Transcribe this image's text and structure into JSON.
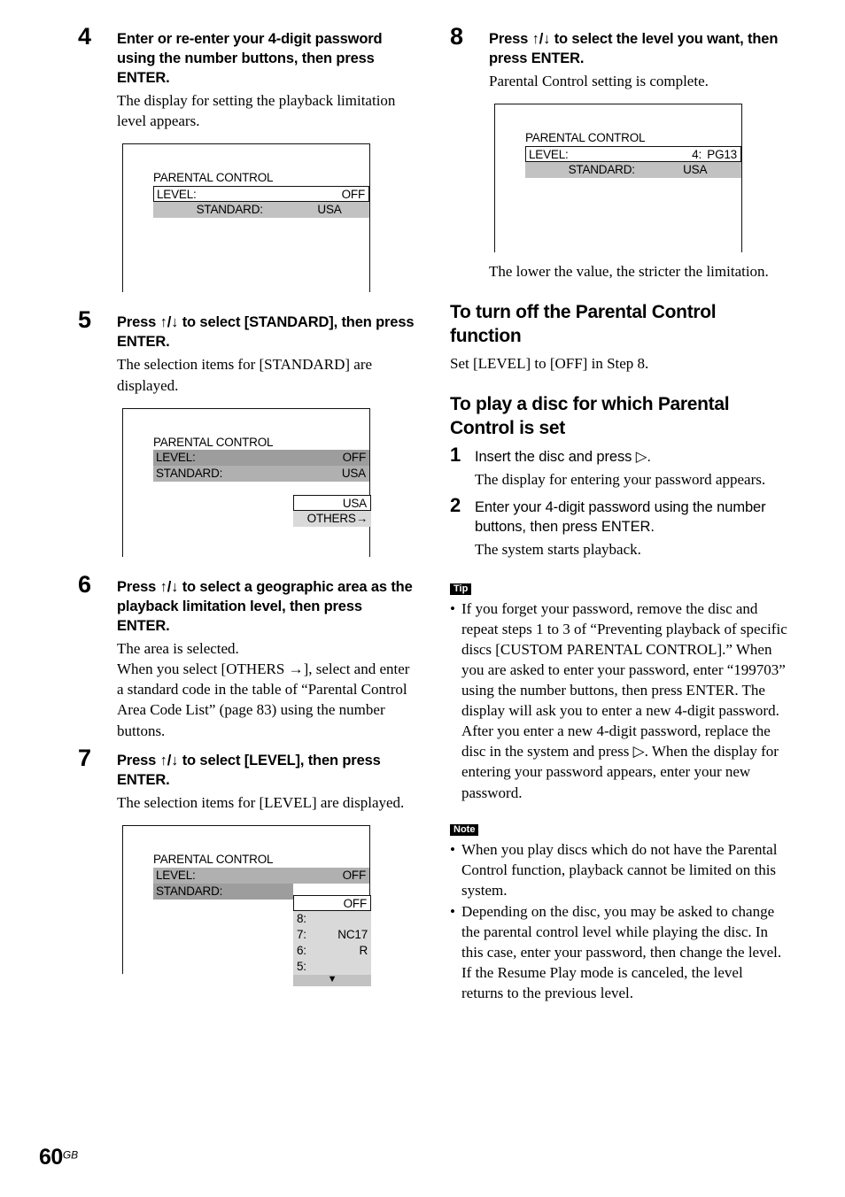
{
  "page": {
    "number": "60",
    "region_suffix": "GB"
  },
  "glyphs": {
    "up_down": "↑/↓",
    "play": "▷",
    "right_arrow": "→",
    "down_triangle": "▼"
  },
  "left_column": {
    "steps": [
      {
        "number": "4",
        "title": "Enter or re-enter your 4-digit password using the number buttons, then press ENTER.",
        "description": "The display for setting the playback limitation level appears."
      },
      {
        "number": "5",
        "title": "Press ↑/↓ to select [STANDARD], then press ENTER.",
        "description": "The selection items for [STANDARD] are displayed."
      },
      {
        "number": "6",
        "title": "Press ↑/↓ to select a geographic area as the playback limitation level, then press ENTER.",
        "description": "The area is selected.",
        "description2": "When you select [OTHERS →], select and enter a standard code in the table of “Parental Control Area Code List” (page 83) using the number buttons."
      },
      {
        "number": "7",
        "title": "Press ↑/↓ to select [LEVEL], then press ENTER.",
        "description": "The selection items for [LEVEL] are displayed."
      }
    ],
    "screens": [
      {
        "title": "PARENTAL CONTROL",
        "rows": [
          {
            "label": "LEVEL:",
            "value": "OFF",
            "style": "row-white"
          },
          {
            "label": "STANDARD:",
            "value": "USA",
            "style": "row-gray-l"
          }
        ]
      },
      {
        "title": "PARENTAL CONTROL",
        "rows": [
          {
            "label": "LEVEL:",
            "value": "OFF",
            "style": "row-gray-d"
          },
          {
            "label": "STANDARD:",
            "value": "USA",
            "style": "row-gray-m"
          }
        ],
        "dropdown": {
          "selected": "USA",
          "options": [
            "OTHERS→"
          ]
        }
      },
      {
        "title": "PARENTAL CONTROL",
        "rows": [
          {
            "label": "LEVEL:",
            "value": "OFF",
            "style": "row-gray-m"
          },
          {
            "label": "STANDARD:",
            "value": "",
            "style": "row-gray-d"
          }
        ],
        "level_dropdown": {
          "selected": "OFF",
          "levels": [
            {
              "rank": "8:",
              "name": ""
            },
            {
              "rank": "7:",
              "name": "NC17"
            },
            {
              "rank": "6:",
              "name": "R"
            },
            {
              "rank": "5:",
              "name": ""
            }
          ],
          "scroll_indicator": "▼"
        }
      }
    ]
  },
  "right_column": {
    "step8": {
      "number": "8",
      "title": "Press ↑/↓ to select the level you want, then press ENTER.",
      "description": "Parental Control setting is complete.",
      "after_screen": "The lower the value, the stricter the limitation."
    },
    "screen8": {
      "title": "PARENTAL CONTROL",
      "rows": [
        {
          "label": "LEVEL:",
          "value": "PG13",
          "value2": "4:",
          "style": "row-white"
        },
        {
          "label": "STANDARD:",
          "value": "USA",
          "style": "row-gray-l"
        }
      ]
    },
    "section_turn_off": {
      "heading": "To turn off the Parental Control function",
      "body": "Set [LEVEL] to [OFF] in Step 8."
    },
    "section_play_disc": {
      "heading": "To play a disc for which Parental Control is set",
      "steps": [
        {
          "number": "1",
          "title": "Insert the disc and press ▷.",
          "description": "The display for entering your password appears."
        },
        {
          "number": "2",
          "title": "Enter your 4-digit password using the number buttons, then press ENTER.",
          "description": "The system starts playback."
        }
      ]
    },
    "tip": {
      "badge": "Tip",
      "bullets": [
        "If you forget your password, remove the disc and repeat steps 1 to 3 of “Preventing playback of specific discs [CUSTOM PARENTAL CONTROL].” When you are asked to enter your password, enter “199703” using the number buttons, then press ENTER. The display will ask you to enter a new 4-digit password. After you enter a new 4-digit password, replace the disc in the system and press ▷. When the display for entering your password appears, enter your new password."
      ]
    },
    "note": {
      "badge": "Note",
      "bullets": [
        "When you play discs which do not have the Parental Control function, playback cannot be limited on this system.",
        "Depending on the disc, you may be asked to change the parental control level while playing the disc. In this case, enter your password, then change the level. If the Resume Play mode is canceled, the level returns to the previous level."
      ]
    }
  }
}
